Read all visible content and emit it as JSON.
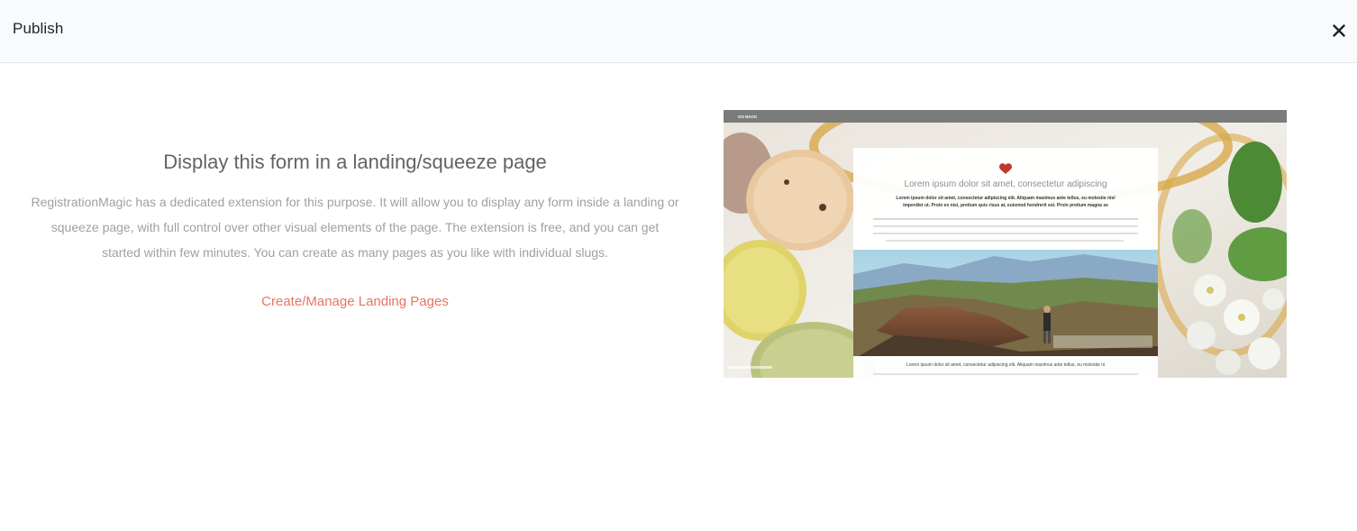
{
  "modal": {
    "title": "Publish",
    "close_icon": "close-icon"
  },
  "content": {
    "heading": "Display this form in a landing/squeeze page",
    "description": "RegistrationMagic has a dedicated extension for this purpose. It will allow you to display any form inside a landing or squeeze page, with full control over other visual elements of the page. The extension is free, and you can get started within few minutes. You can create as many pages as you like with individual slugs.",
    "link_label": "Create/Manage Landing Pages",
    "link_color": "#e87461"
  },
  "preview": {
    "topbar_label": "GO BACK",
    "card_heading": "Lorem ipsum dolor sit amet, consectetur adipiscing",
    "card_bold_text_1": "Lorem ipsum dolor sit amet, consectetur adipiscing elit. Aliquam maximus ante tellus, eu molestie nisl",
    "card_bold_text_2": "imperdiet ut. Proin ex nisi, pretium quis risus at, euismod hendrerit est. Proin pretium magna se",
    "card_footer_text": "Lorem ipsum dolor sit amet, consectetur adipiscing elit. Aliquam maximus ante tellus, eu molestie ni",
    "heart_icon": "heart-icon",
    "accent_color": "#c0392b"
  }
}
